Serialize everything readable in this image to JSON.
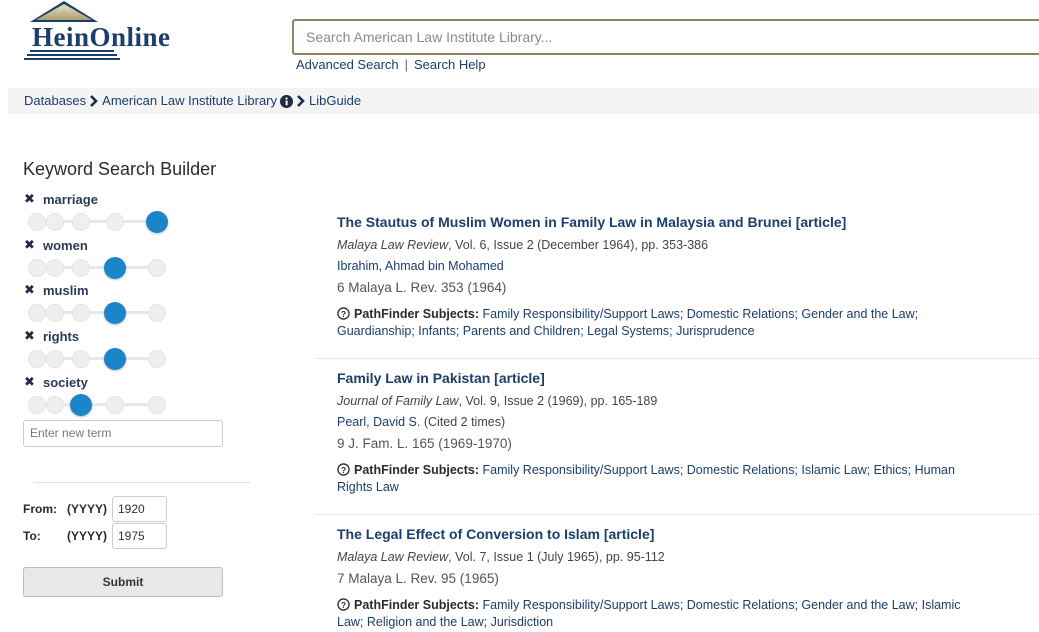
{
  "brand": {
    "name": "HeinOnline",
    "colors": {
      "navy": "#1b3e6b",
      "accent": "#1a86c9",
      "gold": "#8c8560"
    }
  },
  "search": {
    "placeholder": "Search American Law Institute Library...",
    "advanced_label": "Advanced Search",
    "help_label": "Search Help"
  },
  "breadcrumb": {
    "items": [
      "Databases",
      "American Law Institute Library",
      "LibGuide"
    ]
  },
  "keyword_builder": {
    "title": "Keyword Search Builder",
    "terms": [
      {
        "label": "marriage",
        "level": 5,
        "max": 5
      },
      {
        "label": "women",
        "level": 4,
        "max": 5
      },
      {
        "label": "muslim",
        "level": 4,
        "max": 5
      },
      {
        "label": "rights",
        "level": 4,
        "max": 5
      },
      {
        "label": "society",
        "level": 3,
        "max": 5
      }
    ],
    "new_term_placeholder": "Enter new term",
    "from_label": "From:",
    "to_label": "To:",
    "format_label": "(YYYY)",
    "from_value": "1920",
    "to_value": "1975",
    "submit_label": "Submit"
  },
  "results": [
    {
      "title": "The Stautus of Muslim Women in Family Law in Malaysia and Brunei [article]",
      "journal": "Malaya Law Review",
      "details": ", Vol. 6, Issue 2 (December 1964), pp. 353-386",
      "author": "Ibrahim, Ahmad bin Mohamed",
      "cited": "",
      "short_cite": "6 Malaya L. Rev. 353 (1964)",
      "subjects_label": "PathFinder Subjects:",
      "subjects": "Family Responsibility/Support Laws; Domestic Relations; Gender and the Law; Guardianship; Infants; Parents and Children; Legal Systems; Jurisprudence"
    },
    {
      "title": "Family Law in Pakistan [article]",
      "journal": "Journal of Family Law",
      "details": ", Vol. 9, Issue 2 (1969), pp. 165-189",
      "author": "Pearl, David S.",
      "cited": " (Cited 2 times)",
      "short_cite": "9 J. Fam. L. 165 (1969-1970)",
      "subjects_label": "PathFinder Subjects:",
      "subjects": "Family Responsibility/Support Laws; Domestic Relations; Islamic Law; Ethics; Human Rights Law"
    },
    {
      "title": "The Legal Effect of Conversion to Islam [article]",
      "journal": "Malaya Law Review",
      "details": ", Vol. 7, Issue 1 (July 1965), pp. 95-112",
      "author": "",
      "cited": "",
      "short_cite": "7 Malaya L. Rev. 95 (1965)",
      "subjects_label": "PathFinder Subjects:",
      "subjects": "Family Responsibility/Support Laws; Domestic Relations; Gender and the Law; Islamic Law; Religion and the Law; Jurisdiction"
    }
  ]
}
